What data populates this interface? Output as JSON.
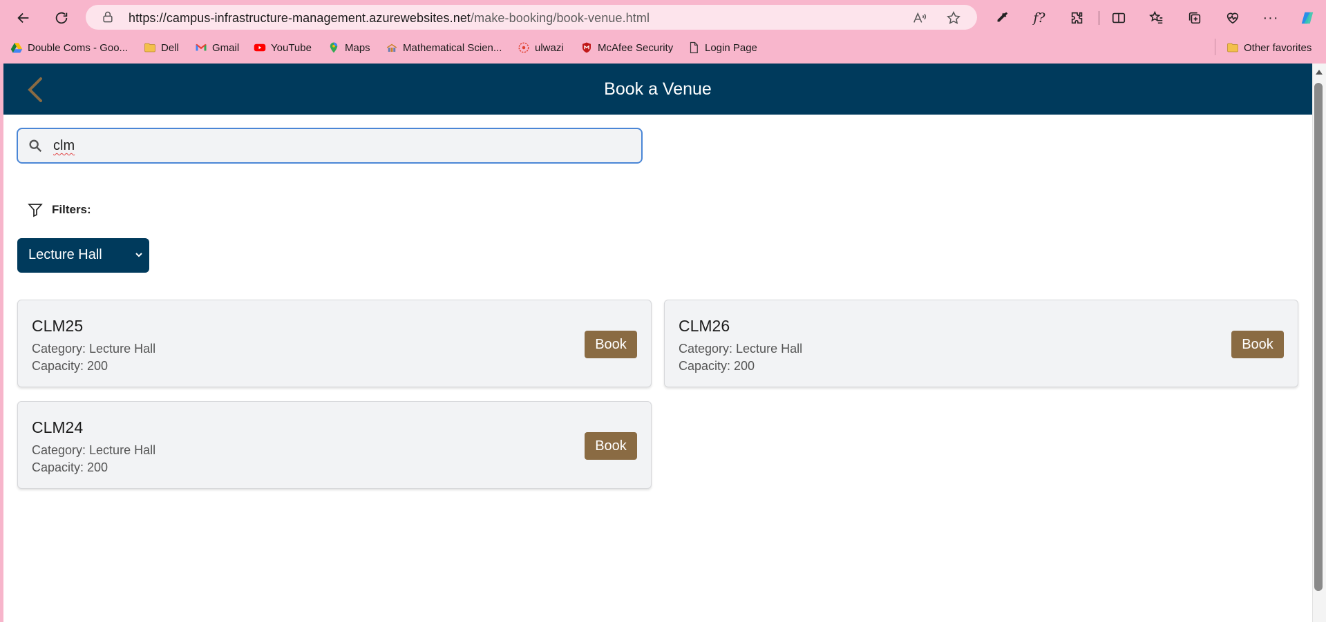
{
  "browser": {
    "url_host": "https://campus-infrastructure-management.azurewebsites.net",
    "url_path": "/make-booking/book-venue.html",
    "bookmarks": [
      {
        "label": "Double Coms - Goo...",
        "icon": "google-drive-icon"
      },
      {
        "label": "Dell",
        "icon": "folder-icon"
      },
      {
        "label": "Gmail",
        "icon": "gmail-icon"
      },
      {
        "label": "YouTube",
        "icon": "youtube-icon"
      },
      {
        "label": "Maps",
        "icon": "maps-icon"
      },
      {
        "label": "Mathematical Scien...",
        "icon": "site-icon"
      },
      {
        "label": "ulwazi",
        "icon": "ulwazi-icon"
      },
      {
        "label": "McAfee Security",
        "icon": "mcafee-icon"
      },
      {
        "label": "Login Page",
        "icon": "page-icon"
      }
    ],
    "other_favorites": "Other favorites"
  },
  "page": {
    "title": "Book a Venue",
    "search_value": "clm",
    "filters_label": "Filters:",
    "category_selected": "Lecture Hall"
  },
  "venues": [
    {
      "name": "CLM25",
      "category": "Category: Lecture Hall",
      "capacity": "Capacity: 200",
      "button": "Book"
    },
    {
      "name": "CLM26",
      "category": "Category: Lecture Hall",
      "capacity": "Capacity: 200",
      "button": "Book"
    },
    {
      "name": "CLM24",
      "category": "Category: Lecture Hall",
      "capacity": "Capacity: 200",
      "button": "Book"
    }
  ],
  "colors": {
    "header": "#003a5c",
    "book_button": "#8a6b43",
    "browser_frame": "#f8b6cc"
  }
}
